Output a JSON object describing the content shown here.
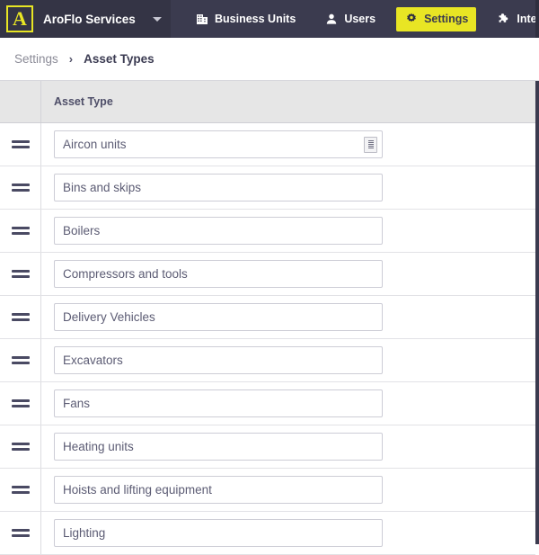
{
  "topbar": {
    "logo_letter": "A",
    "brand_name": "AroFlo Services",
    "caret_icon": "chevron-down-icon",
    "nav": [
      {
        "label": "Business Units",
        "icon": "building-icon",
        "active": false
      },
      {
        "label": "Users",
        "icon": "user-icon",
        "active": false
      },
      {
        "label": "Settings",
        "icon": "gear-icon",
        "active": true
      },
      {
        "label": "Integration",
        "icon": "puzzle-piece-icon",
        "active": false
      }
    ],
    "accent_color": "#e8e524",
    "bar_color": "#3b3b4f"
  },
  "breadcrumb": {
    "parent": "Settings",
    "separator": "›",
    "current": "Asset Types"
  },
  "table": {
    "columns": [
      "",
      "Asset Type"
    ],
    "header_label": "Asset Type",
    "field_placeholder": "Asset Type",
    "handle_icon": "drag-handle-icon",
    "resize_icon": "resize-grip-icon",
    "rows": [
      {
        "value": "Aircon units",
        "has_icon": true
      },
      {
        "value": "Bins and skips",
        "has_icon": false
      },
      {
        "value": "Boilers",
        "has_icon": false
      },
      {
        "value": "Compressors and tools",
        "has_icon": false
      },
      {
        "value": "Delivery Vehicles",
        "has_icon": false
      },
      {
        "value": "Excavators",
        "has_icon": false
      },
      {
        "value": "Fans",
        "has_icon": false
      },
      {
        "value": "Heating units",
        "has_icon": false
      },
      {
        "value": "Hoists and lifting equipment",
        "has_icon": false
      },
      {
        "value": "Lighting",
        "has_icon": false
      }
    ]
  }
}
